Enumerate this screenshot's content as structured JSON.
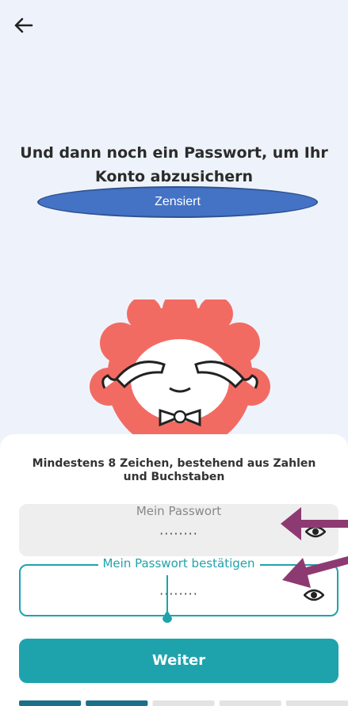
{
  "header": {
    "back_icon": "arrow-left-icon"
  },
  "title": {
    "line1": "Und dann noch ein Passwort, um Ihr",
    "line2": "Konto abzusichern"
  },
  "censor_label": "Zensiert",
  "sheet": {
    "hint_line1": "Mindestens 8 Zeichen, bestehend aus Zahlen",
    "hint_line2": "und Buchstaben",
    "password_field": {
      "label": "Mein Passwort",
      "value": "········"
    },
    "confirm_field": {
      "label": "Mein Passwort bestätigen",
      "value": "········"
    },
    "next_button": "Weiter"
  },
  "progress": {
    "total_steps": 5,
    "completed_steps": 2
  },
  "colors": {
    "accent": "#1ea3ad",
    "mascot": "#f26b63",
    "annotation_arrow": "#8e3a72"
  }
}
